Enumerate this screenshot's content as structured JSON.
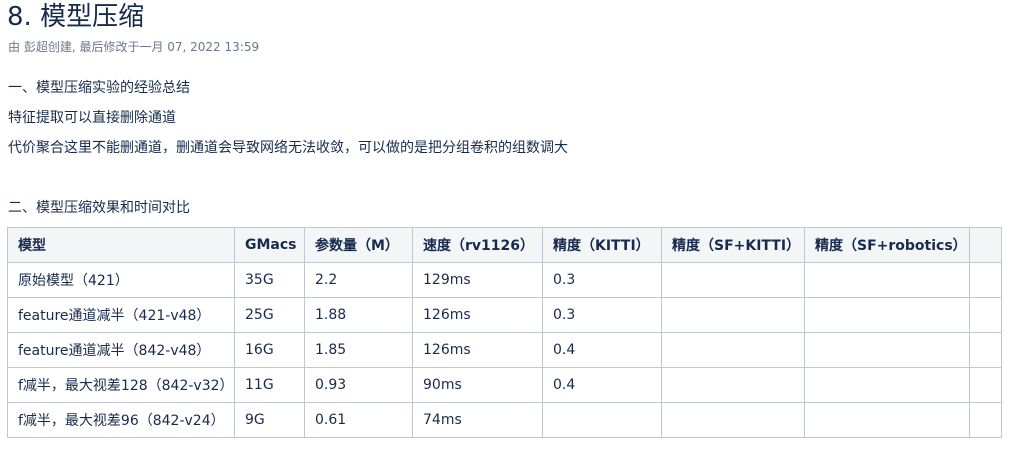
{
  "page": {
    "title": "8. 模型压缩",
    "meta": "由 彭超创建, 最后修改于一月 07, 2022 13:59"
  },
  "content": {
    "section1_heading": "一、模型压缩实验的经验总结",
    "line1": "特征提取可以直接删除通道",
    "line2": "代价聚合这里不能删通道，删通道会导致网络无法收敛，可以做的是把分组卷积的组数调大",
    "section2_heading": "二、模型压缩效果和时间对比"
  },
  "table": {
    "headers": [
      "模型",
      "GMacs",
      "参数量（M）",
      "速度（rv1126）",
      "精度（KITTI）",
      "精度（SF+KITTI）",
      "精度（SF+robotics）",
      ""
    ],
    "rows": [
      [
        "原始模型（421）",
        "35G",
        "2.2",
        "129ms",
        "0.3",
        "",
        "",
        ""
      ],
      [
        "feature通道减半（421-v48）",
        "25G",
        "1.88",
        "126ms",
        "0.3",
        "",
        "",
        ""
      ],
      [
        "feature通道减半（842-v48）",
        "16G",
        "1.85",
        "126ms",
        "0.4",
        "",
        "",
        ""
      ],
      [
        "f减半，最大视差128（842-v32）",
        "11G",
        "0.93",
        "90ms",
        "0.4",
        "",
        "",
        ""
      ],
      [
        "f减半，最大视差96（842-v24）",
        "9G",
        "0.61",
        "74ms",
        "",
        "",
        "",
        ""
      ]
    ]
  }
}
